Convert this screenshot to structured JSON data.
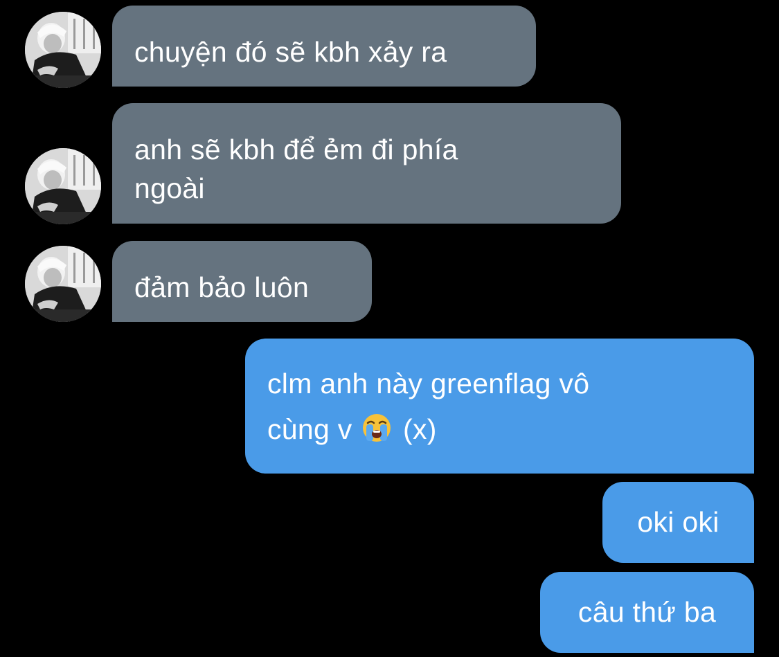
{
  "chat": {
    "messages": [
      {
        "sender": "other",
        "text": "chuyện đó sẽ kbh xảy ra"
      },
      {
        "sender": "other",
        "line1": "anh sẽ kbh để ẻm đi phía",
        "line2": "ngoài"
      },
      {
        "sender": "other",
        "text": "đảm bảo luôn"
      },
      {
        "sender": "me",
        "line1": "clm anh này greenflag vô",
        "line2_before": "cùng v",
        "emoji": "loudly-crying-face-icon",
        "line2_after": "(x)"
      },
      {
        "sender": "me",
        "text": "oki oki"
      },
      {
        "sender": "me",
        "text": "câu thứ ba"
      }
    ]
  },
  "colors": {
    "background": "#000000",
    "incoming_bubble": "#65737f",
    "outgoing_bubble": "#4a9be8",
    "text": "#ffffff"
  }
}
